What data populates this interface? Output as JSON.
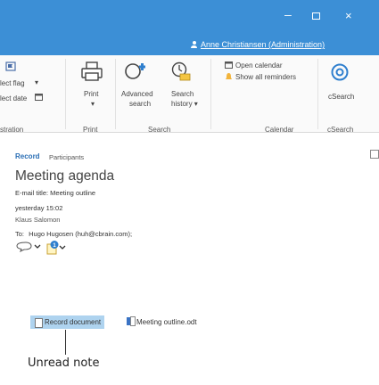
{
  "window": {
    "minimize_glyph": "‒",
    "close_glyph": "×",
    "user_name": "Anne Christiansen (Administration)"
  },
  "ribbon": {
    "colors": {
      "accent": "#3c8fd6",
      "background": "#fafafa"
    },
    "left_partial": {
      "select_flag": "lect flag",
      "select_date": "lect date",
      "group": "stration"
    },
    "print": {
      "label": "Print",
      "dropdown_glyph": "▾",
      "group": "Print"
    },
    "search": {
      "advanced_line1": "Advanced",
      "advanced_line2": "search",
      "history_line1": "Search",
      "history_line2": "history ▾",
      "group": "Search"
    },
    "calendar": {
      "open_calendar": "Open calendar",
      "show_all_reminders": "Show all reminders",
      "group": "Calendar"
    },
    "csearch": {
      "label": "cSearch",
      "group": "cSearch"
    }
  },
  "record": {
    "tabs": [
      {
        "label": "Record",
        "active": true
      },
      {
        "label": "Participants",
        "active": false
      }
    ],
    "title": "Meeting agenda",
    "email_title": "E-mail title: Meeting outline",
    "timestamp": "yesterday 15:02",
    "author": "Klaus Salomon",
    "to_label": "To:",
    "to_value": "Hugo Hugosen (huh@cbrain.com);",
    "note_badge_count": "1",
    "documents": [
      {
        "label": "Record document",
        "selected": true
      },
      {
        "label": "Meeting outline.odt",
        "selected": false
      }
    ]
  },
  "annotation": {
    "label": "Unread note"
  }
}
